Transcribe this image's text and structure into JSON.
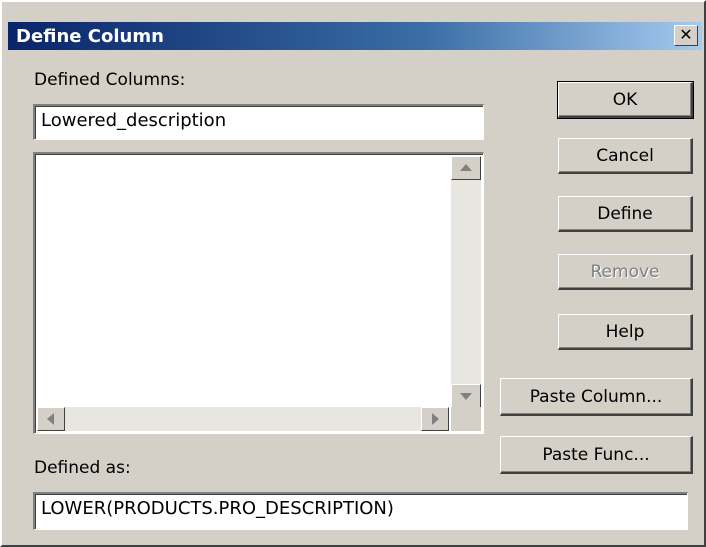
{
  "window": {
    "title": "Define Column",
    "close_glyph": "✕"
  },
  "labels": {
    "defined_columns": "Defined Columns:",
    "defined_as": "Defined as:"
  },
  "fields": {
    "column_name": "Lowered_description",
    "expression": "LOWER(PRODUCTS.PRO_DESCRIPTION)"
  },
  "list": {
    "items": []
  },
  "buttons": {
    "ok": "OK",
    "cancel": "Cancel",
    "define": "Define",
    "remove": "Remove",
    "help": "Help",
    "paste_column": "Paste Column...",
    "paste_func": "Paste Func..."
  },
  "icons": {
    "close": "close-icon",
    "scroll_up": "scroll-up-arrow-icon",
    "scroll_down": "scroll-down-arrow-icon",
    "scroll_left": "scroll-left-arrow-icon",
    "scroll_right": "scroll-right-arrow-icon"
  }
}
